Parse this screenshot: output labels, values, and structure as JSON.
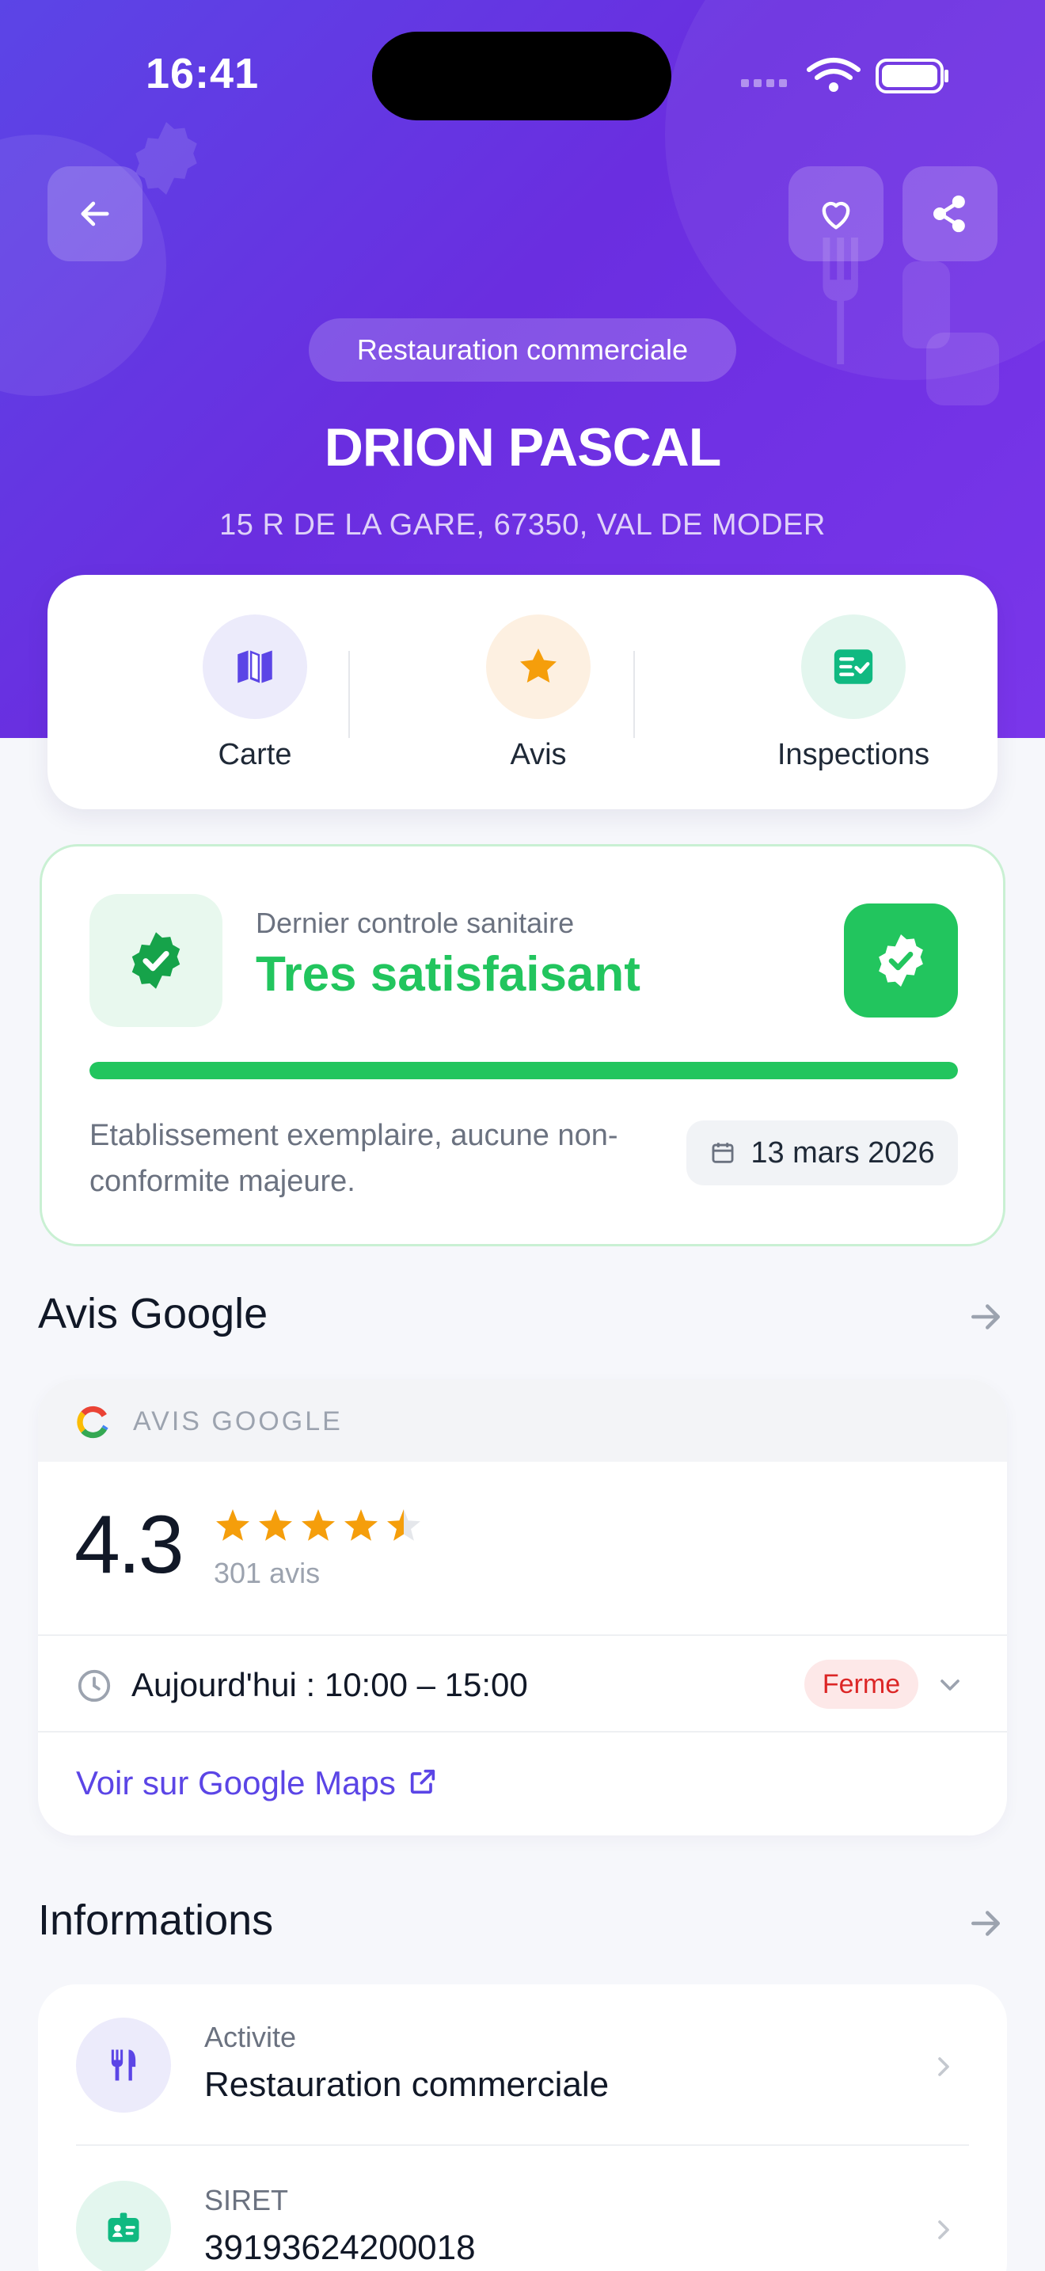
{
  "status_bar": {
    "time": "16:41"
  },
  "header": {
    "category": "Restauration commerciale",
    "name": "DRION PASCAL",
    "address": "15  R   DE LA GARE, 67350, VAL DE MODER"
  },
  "quick_actions": [
    {
      "label": "Carte",
      "icon": "map-icon"
    },
    {
      "label": "Avis",
      "icon": "star-icon"
    },
    {
      "label": "Inspections",
      "icon": "checklist-icon"
    }
  ],
  "inspection": {
    "label": "Dernier controle sanitaire",
    "result": "Tres satisfaisant",
    "progress": 1.0,
    "description": "Etablissement exemplaire, aucune non-conformite majeure.",
    "date": "13 mars 2026",
    "color": "#22c55e"
  },
  "google_section": {
    "title": "Avis Google",
    "card_header": "AVIS GOOGLE",
    "rating": "4.3",
    "rating_value": 4.3,
    "review_count": "301 avis",
    "hours": "Aujourd'hui : 10:00 – 15:00",
    "status": "Ferme",
    "maps_link": "Voir sur Google Maps"
  },
  "info_section": {
    "title": "Informations",
    "rows": [
      {
        "label": "Activite",
        "value": "Restauration commerciale",
        "icon": "utensils-icon"
      },
      {
        "label": "SIRET",
        "value": "39193624200018",
        "icon": "id-badge-icon"
      }
    ]
  },
  "colors": {
    "primary": "#5b45e6",
    "success": "#22c55e",
    "danger": "#dc2626",
    "star": "#f59e0b"
  }
}
